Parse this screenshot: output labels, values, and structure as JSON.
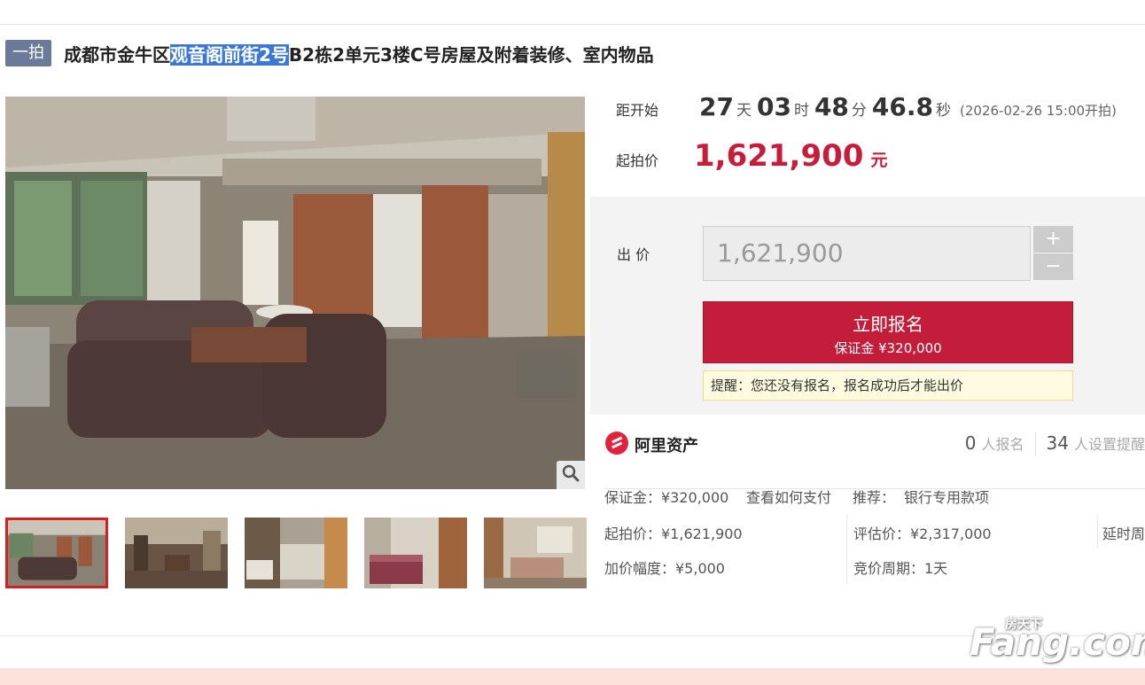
{
  "header": {
    "badge": "一拍",
    "title_before": "成都市金牛区",
    "title_highlight": "观音阁前街2号",
    "title_after": "B2栋2单元3楼C号房屋及附着装修、室内物品"
  },
  "countdown": {
    "label": "距开始",
    "days": "27",
    "days_unit": "天",
    "hours": "03",
    "hours_unit": "时",
    "minutes": "48",
    "minutes_unit": "分",
    "seconds": "46.8",
    "seconds_unit": "秒",
    "note": "(2026-02-26 15:00开拍)"
  },
  "start_price": {
    "label": "起拍价",
    "value": "1,621,900",
    "unit": "元"
  },
  "bid": {
    "label": "出 价",
    "input_value": "1,621,900",
    "plus": "+",
    "minus": "−",
    "signup_label": "立即报名",
    "deposit_label": "保证金 ¥320,000",
    "tip": "提醒：您还没有报名，报名成功后才能出价"
  },
  "platform": {
    "name": "阿里资产",
    "registered_count": "0",
    "registered_unit": "人报名",
    "reminder_count": "34",
    "reminder_unit": "人设置提醒",
    "brand_color": "#e2223c"
  },
  "info": {
    "deposit": "保证金：¥320,000",
    "how_to_pay": "查看如何支付",
    "recommend_label": "推荐：",
    "bank_link": "银行专用款项",
    "start_price": "起拍价：¥1,621,900",
    "appraisal": "评估价：¥2,317,000",
    "delay": "延时周",
    "increment": "加价幅度：¥5,000",
    "period": "竞价周期：1天"
  },
  "gallery": {
    "thumb_count": 5,
    "selected_index": 0
  },
  "watermark": {
    "text": "Fang.com",
    "sub": "房天下"
  }
}
